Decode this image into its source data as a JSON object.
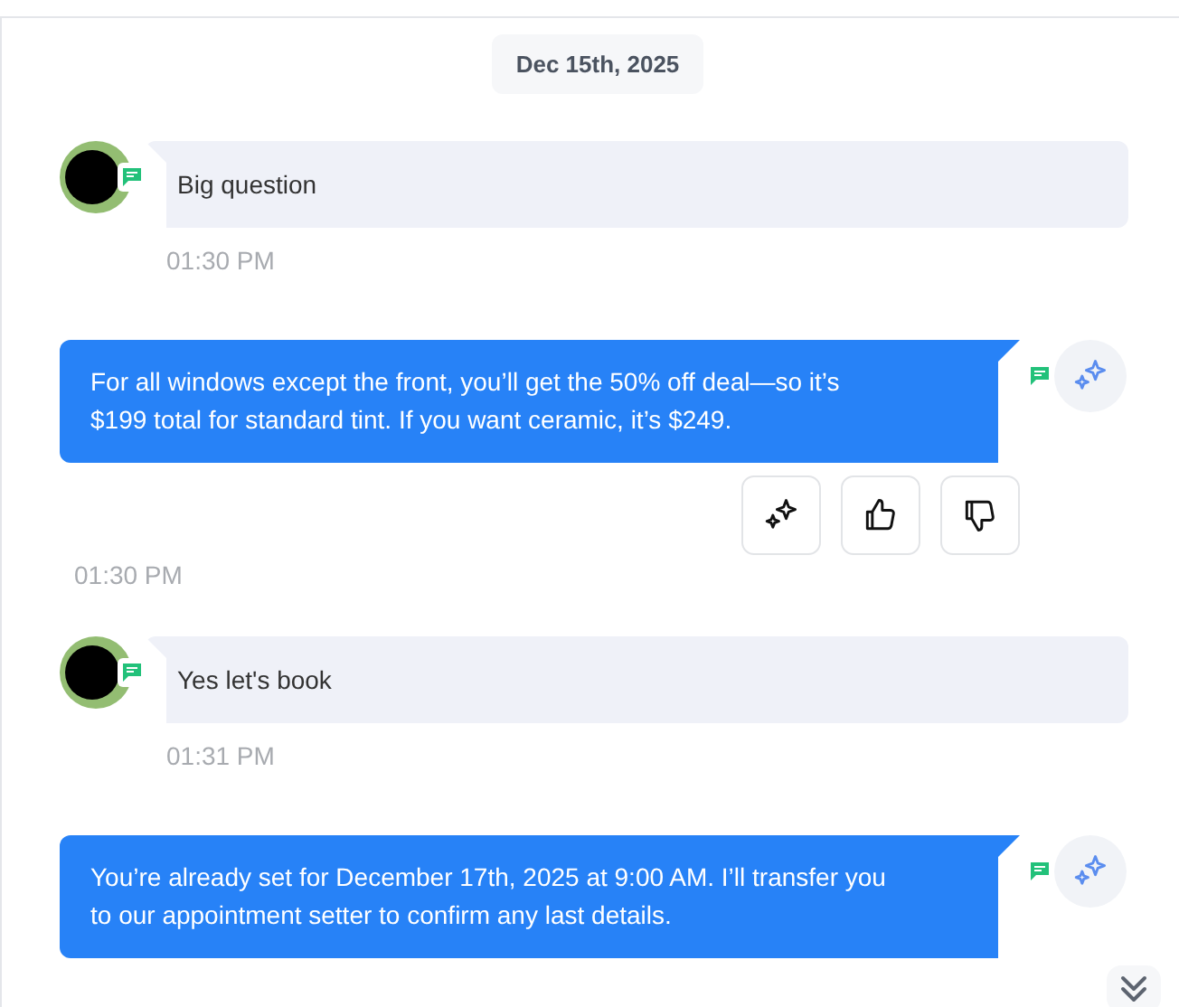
{
  "date_chip": "Dec 15th, 2025",
  "messages": [
    {
      "kind": "customer",
      "text": "Big question",
      "time": "01:30 PM"
    },
    {
      "kind": "bot",
      "text": "For all windows except the front, you’ll get the 50% off deal—so it’s $199 total for standard tint. If you want ceramic, it’s $249.",
      "actions": true,
      "time": "01:30 PM"
    },
    {
      "kind": "customer",
      "text": "Yes let's book",
      "time": "01:31 PM"
    },
    {
      "kind": "bot",
      "text": "You’re already set for December 17th, 2025 at 9:00 AM. I’ll transfer you to our appointment setter to confirm any last details.",
      "actions": false
    }
  ]
}
